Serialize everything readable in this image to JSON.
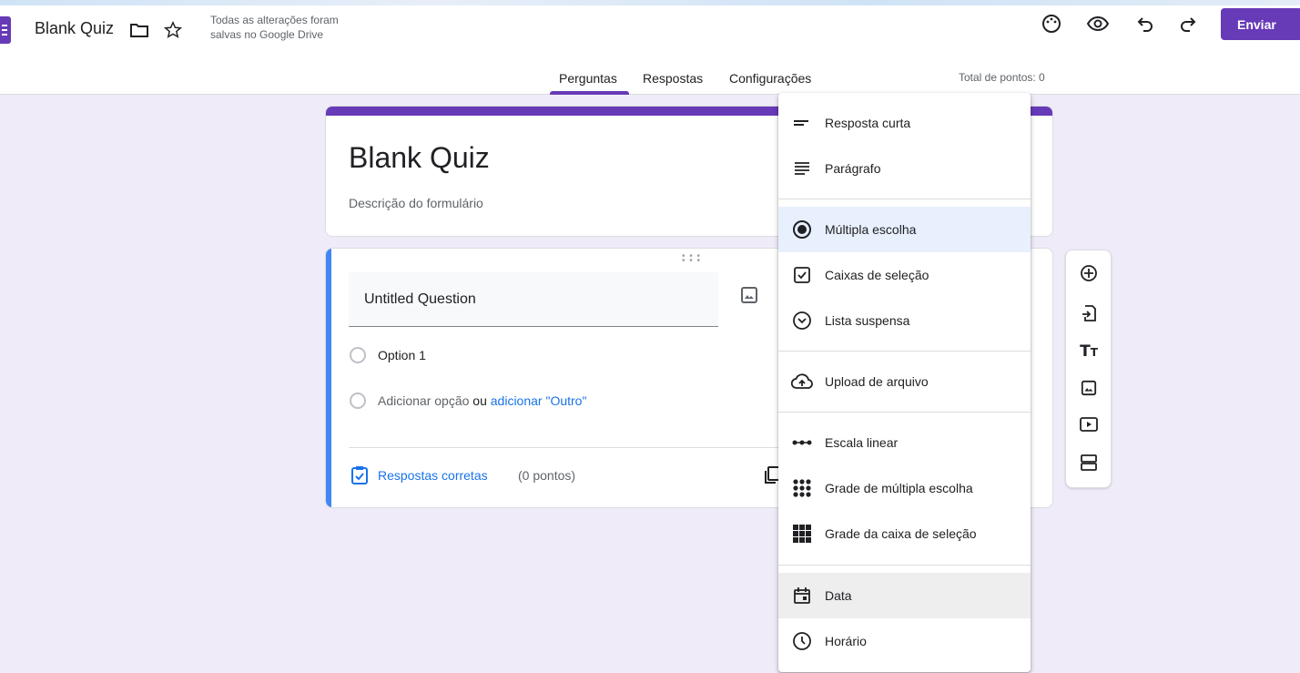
{
  "header": {
    "doc_title": "Blank Quiz",
    "save_status": "Todas as alterações foram salvas no Google Drive",
    "send_label": "Enviar",
    "icons": [
      "folder-icon",
      "star-icon",
      "palette-icon",
      "eye-icon",
      "undo-icon",
      "redo-icon"
    ]
  },
  "tabs": [
    {
      "label": "Perguntas",
      "active": true
    },
    {
      "label": "Respostas",
      "active": false
    },
    {
      "label": "Configurações",
      "active": false
    }
  ],
  "total_points": "Total de pontos: 0",
  "form": {
    "title": "Blank Quiz",
    "description": "Descrição do formulário"
  },
  "question": {
    "title": "Untitled Question",
    "option1": "Option 1",
    "add_option": "Adicionar opção",
    "or": "ou",
    "add_other": "adicionar \"Outro\"",
    "answer_key": "Respostas corretas",
    "points": "(0 pontos)"
  },
  "sidebar_icons": [
    "add-question-icon",
    "import-questions-icon",
    "add-title-icon",
    "add-image-icon",
    "add-video-icon",
    "add-section-icon"
  ],
  "menu": {
    "items": [
      {
        "label": "Resposta curta",
        "icon": "short-answer-icon"
      },
      {
        "label": "Parágrafo",
        "icon": "paragraph-icon"
      },
      {
        "label": "Múltipla escolha",
        "icon": "radio-icon",
        "selected": true
      },
      {
        "label": "Caixas de seleção",
        "icon": "checkbox-icon"
      },
      {
        "label": "Lista suspensa",
        "icon": "dropdown-icon"
      },
      {
        "label": "Upload de arquivo",
        "icon": "cloud-upload-icon"
      },
      {
        "label": "Escala linear",
        "icon": "linear-scale-icon"
      },
      {
        "label": "Grade de múltipla escolha",
        "icon": "grid-dots-icon"
      },
      {
        "label": "Grade da caixa de seleção",
        "icon": "grid-squares-icon"
      },
      {
        "label": "Data",
        "icon": "calendar-icon",
        "hover": true
      },
      {
        "label": "Horário",
        "icon": "clock-icon"
      }
    ]
  },
  "colors": {
    "accent": "#673ab7",
    "background": "#f0ebf8",
    "link": "#1a73e8",
    "question_bar": "#4285f4"
  }
}
